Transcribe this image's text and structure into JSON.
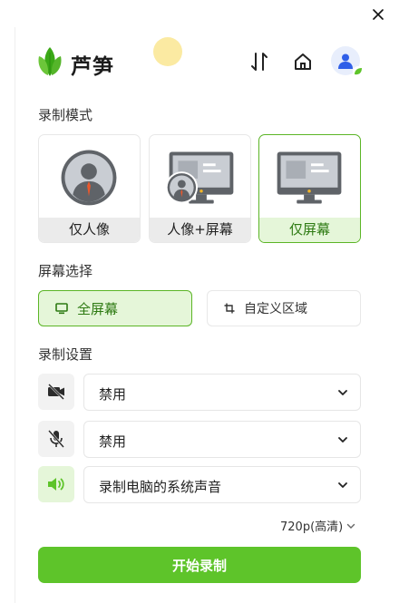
{
  "app": {
    "brand": "芦笋"
  },
  "header": {
    "icons": [
      "sort-icon",
      "home-icon",
      "user-avatar-icon"
    ]
  },
  "record_mode": {
    "title": "录制模式",
    "options": [
      {
        "label": "仅人像",
        "selected": false
      },
      {
        "label": "人像+屏幕",
        "selected": false
      },
      {
        "label": "仅屏幕",
        "selected": true
      }
    ]
  },
  "screen_select": {
    "title": "屏幕选择",
    "options": [
      {
        "label": "全屏幕",
        "icon": "monitor-icon",
        "selected": true
      },
      {
        "label": "自定义区域",
        "icon": "crop-icon",
        "selected": false
      }
    ]
  },
  "record_settings": {
    "title": "录制设置",
    "camera": {
      "icon": "camera-off-icon",
      "value": "禁用"
    },
    "microphone": {
      "icon": "mic-off-icon",
      "value": "禁用"
    },
    "system_audio": {
      "icon": "speaker-icon",
      "value": "录制电脑的系统声音"
    }
  },
  "quality": {
    "value": "720p(高清)"
  },
  "start_button": {
    "label": "开始录制"
  },
  "colors": {
    "accent": "#5ec42a",
    "accent_light": "#e5f6d9",
    "accent_border": "#5bb526",
    "avatar_blue": "#2f5fe8"
  }
}
